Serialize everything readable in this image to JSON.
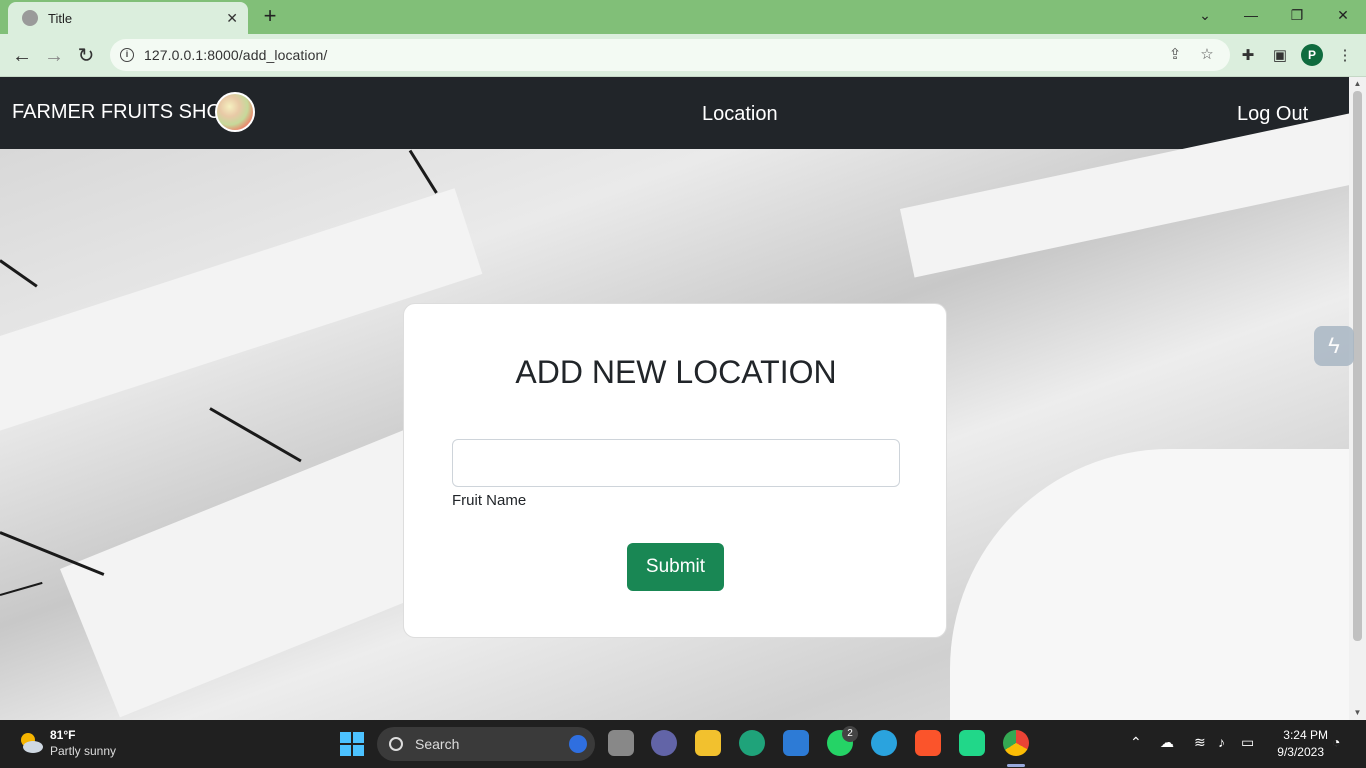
{
  "browser": {
    "tab_title": "Title",
    "tab_close": "✕",
    "new_tab": "+",
    "url": "127.0.0.1:8000/add_location/",
    "profile_initial": "P",
    "window_controls": {
      "minimize": "—",
      "restore": "❐",
      "close": "✕",
      "tab_list": "⌄"
    }
  },
  "navbar": {
    "brand": "FARMER FRUITS SHOP",
    "links": {
      "location": "Location",
      "logout": "Log Out"
    }
  },
  "form": {
    "title": "ADD NEW LOCATION",
    "input_value": "",
    "input_label": "Fruit Name",
    "submit_label": "Submit"
  },
  "taskbar": {
    "weather_temp": "81°F",
    "weather_desc": "Partly sunny",
    "search_label": "Search",
    "whatsapp_badge": "2",
    "time": "3:24 PM",
    "date": "9/3/2023"
  },
  "icons": [
    "back-icon",
    "forward-icon",
    "reload-icon",
    "info-icon",
    "share-icon",
    "star-icon",
    "extensions-icon",
    "sidepanel-icon",
    "menu-icon"
  ],
  "colors": {
    "tab_bar": "#81bf78",
    "navbar": "#212529",
    "submit": "#198754",
    "taskbar": "#202020"
  }
}
